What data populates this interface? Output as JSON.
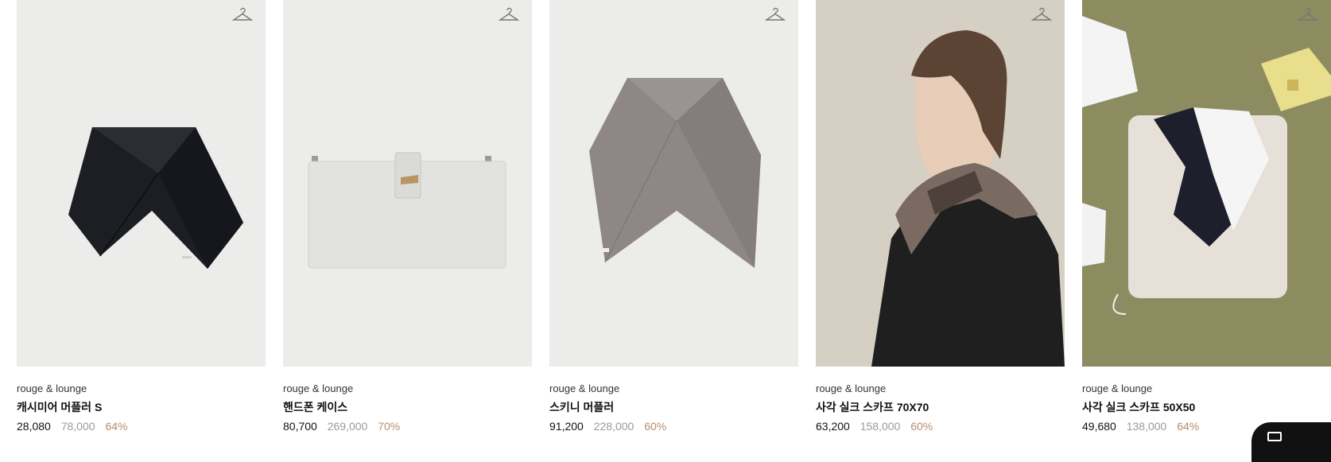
{
  "products": [
    {
      "brand": "rouge & lounge",
      "name": "캐시미어 머플러 S",
      "price": "28,080",
      "original_price": "78,000",
      "discount": "64%",
      "wishlist_icon": "hanger-icon"
    },
    {
      "brand": "rouge & lounge",
      "name": "핸드폰 케이스",
      "price": "80,700",
      "original_price": "269,000",
      "discount": "70%",
      "wishlist_icon": "hanger-icon"
    },
    {
      "brand": "rouge & lounge",
      "name": "스키니 머플러",
      "price": "91,200",
      "original_price": "228,000",
      "discount": "60%",
      "wishlist_icon": "hanger-icon"
    },
    {
      "brand": "rouge & lounge",
      "name": "사각 실크 스카프 70X70",
      "price": "63,200",
      "original_price": "158,000",
      "discount": "60%",
      "wishlist_icon": "hanger-icon"
    },
    {
      "brand": "rouge & lounge",
      "name": "사각 실크 스카프 50X50",
      "price": "49,680",
      "original_price": "138,000",
      "discount": "64%",
      "wishlist_icon": "hanger-icon"
    }
  ],
  "colors": {
    "discount": "#b98c6a",
    "original_price": "#9a9a9a",
    "image_bg": "#ececea",
    "olive_bg": "#8d8b60"
  },
  "floating_button_icon": "chat-icon"
}
